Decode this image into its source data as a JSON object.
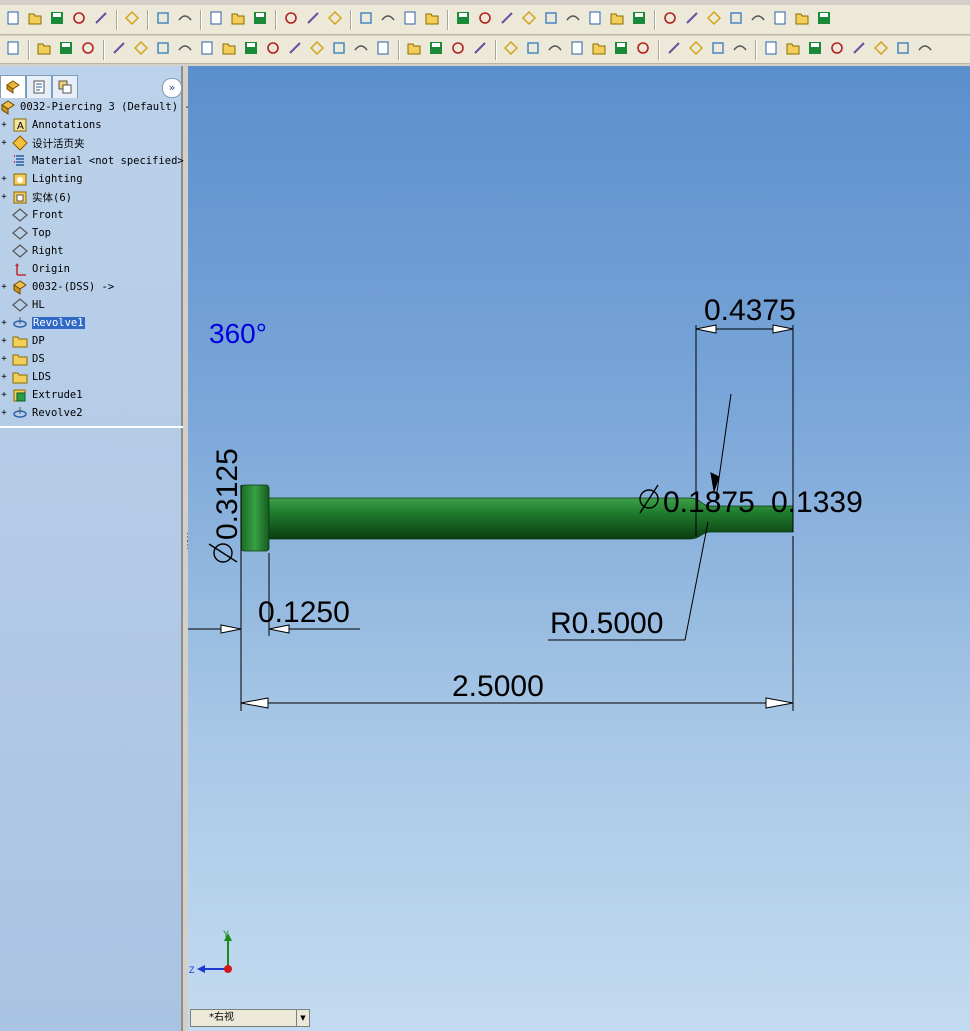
{
  "toolbar_top": {
    "buttons": [
      "new-icon",
      "open-icon",
      "save-icon",
      "print-preview-icon",
      "options-icon",
      "print-icon",
      "undo-icon",
      "redo-icon",
      "select-icon",
      "select-filter-icon",
      "traffic-light-icon",
      "grid-icon",
      "appearance-icon",
      "smart-dim-icon",
      "rebuild-icon",
      "display-style-icon",
      "properties-icon",
      "help-icon",
      "section-view-icon",
      "zoom-to-fit-icon",
      "zoom-area-icon",
      "zoom-in-out-icon",
      "zoom-selection-icon",
      "rotate-icon",
      "pan-icon",
      "3d-view-icon",
      "view-orientation-icon",
      "wireframe-icon",
      "hidden-lines-visible-icon",
      "hidden-lines-removed-icon",
      "shaded-edges-icon",
      "shaded-icon",
      "shadows-icon",
      "perspective-icon",
      "realview-icon"
    ]
  },
  "toolbar_second": {
    "buttons": [
      "sketch-icon",
      "smart-dimension-icon",
      "line-icon",
      "rectangle-icon",
      "circle-icon",
      "arc-icon",
      "polygon-icon",
      "spline-icon",
      "ellipse-icon",
      "fillet-icon",
      "text-icon",
      "point-icon",
      "centerline-icon",
      "mirror-icon",
      "offset-icon",
      "convert-icon",
      "trim-icon",
      "extend-icon",
      "move-icon",
      "rotate-entity-icon",
      "copy-icon",
      "scale-icon",
      "relations-icon",
      "display-relations-icon",
      "repair-icon",
      "quick-snaps-icon",
      "rapid-sketch-icon",
      "instant3d-icon",
      "extrude-boss-icon",
      "revolve-boss-icon",
      "sweep-icon",
      "loft-icon",
      "extrude-cut-icon",
      "revolve-cut-icon",
      "fillet-feature-icon",
      "chamfer-icon",
      "rib-icon",
      "shell-icon",
      "draft-icon",
      "hole-wizard-icon"
    ]
  },
  "tree": {
    "root": "0032-Piercing 3  (Default) -",
    "items": [
      {
        "label": "Annotations",
        "icon": "annotations-icon",
        "expand": "+"
      },
      {
        "label": "设计活页夹",
        "icon": "design-binder-icon",
        "expand": "+"
      },
      {
        "label": "Material <not specified>",
        "icon": "material-icon",
        "expand": ""
      },
      {
        "label": "Lighting",
        "icon": "lighting-icon",
        "expand": "+"
      },
      {
        "label": "实体(6)",
        "icon": "solid-bodies-icon",
        "expand": "+"
      },
      {
        "label": "Front",
        "icon": "plane-icon",
        "expand": ""
      },
      {
        "label": "Top",
        "icon": "plane-icon",
        "expand": ""
      },
      {
        "label": "Right",
        "icon": "plane-icon",
        "expand": ""
      },
      {
        "label": "Origin",
        "icon": "origin-icon",
        "expand": ""
      },
      {
        "label": "0032-(DSS) ->",
        "icon": "part-icon",
        "expand": "+"
      },
      {
        "label": "HL",
        "icon": "plane-icon",
        "expand": ""
      },
      {
        "label": "Revolve1",
        "icon": "revolve-icon",
        "expand": "+",
        "selected": true
      },
      {
        "label": "DP",
        "icon": "folder-icon",
        "expand": "+"
      },
      {
        "label": "DS",
        "icon": "folder-icon",
        "expand": "+"
      },
      {
        "label": "LDS",
        "icon": "folder-icon",
        "expand": "+"
      },
      {
        "label": "Extrude1",
        "icon": "extrude-icon",
        "expand": "+"
      },
      {
        "label": "Revolve2",
        "icon": "revolve-icon",
        "expand": "+"
      }
    ]
  },
  "viewport": {
    "angle_label": "360°",
    "dims": {
      "top_width": "0.4375",
      "head_dia": "0.3125",
      "tip_dia": "0.1875",
      "tip_dia2": "0.1339",
      "head_len": "0.1250",
      "radius": "R0.5000",
      "overall": "2.5000"
    },
    "part_color": "#1e7a2e",
    "angle_color": "#0000e0",
    "triad": {
      "y": "Y",
      "z": "Z"
    }
  },
  "view_select": {
    "value": "*右视"
  }
}
